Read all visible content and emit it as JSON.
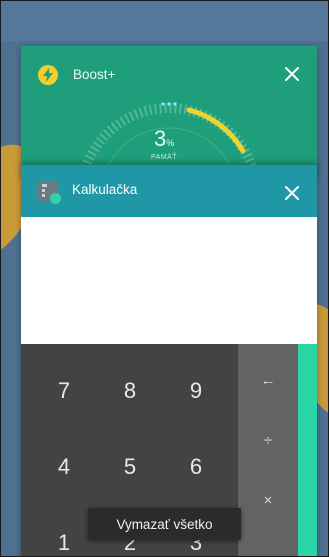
{
  "recents": {
    "cards": [
      {
        "title": "Boost+",
        "icon": "lightning-bolt-icon",
        "color": "#1f9e7c",
        "preview": {
          "value": "3",
          "unit": "%",
          "sublabel": "PAMÄŤ"
        }
      },
      {
        "title": "Kalkulačka",
        "icon": "calculator-icon",
        "color": "#1f97a6",
        "keypad": {
          "digits": [
            "7",
            "8",
            "9",
            "4",
            "5",
            "6",
            "1",
            "2",
            "3"
          ],
          "operators": [
            "←",
            "÷",
            "×"
          ]
        }
      }
    ],
    "clear_all_label": "Vymazať všetko"
  },
  "colors": {
    "boost_green": "#1f9e7c",
    "calc_teal": "#1f97a6",
    "accent_green": "#2bd6a6",
    "gauge_yellow": "#f2d32c"
  }
}
